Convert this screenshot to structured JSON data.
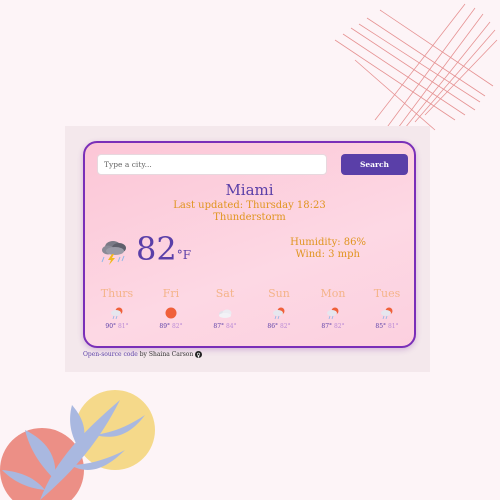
{
  "search": {
    "placeholder": "Type a city...",
    "button_label": "Search"
  },
  "current": {
    "city": "Miami",
    "last_updated": "Last updated: Thursday 18:23",
    "condition": "Thunderstorm",
    "temperature": "82",
    "unit": "°F",
    "humidity": "Humidity: 86%",
    "wind": "Wind: 3 mph",
    "icon": "thunderstorm-icon"
  },
  "forecast": [
    {
      "day": "Thurs",
      "high": "90°",
      "low": "81°",
      "icon": "rain-icon"
    },
    {
      "day": "Fri",
      "high": "89°",
      "low": "82°",
      "icon": "sun-icon"
    },
    {
      "day": "Sat",
      "high": "87°",
      "low": "84°",
      "icon": "cloud-icon"
    },
    {
      "day": "Sun",
      "high": "86°",
      "low": "82°",
      "icon": "rain-icon"
    },
    {
      "day": "Mon",
      "high": "87°",
      "low": "82°",
      "icon": "rain-icon"
    },
    {
      "day": "Tues",
      "high": "85°",
      "low": "81°",
      "icon": "rain-icon"
    }
  ],
  "footer": {
    "link_text": "Open-source code",
    "credit": " by Shaina Carson",
    "icon": "github-icon"
  },
  "colors": {
    "accent": "#5a3fa8",
    "card_border": "#7a2fb8",
    "secondary_text": "#e09520",
    "day_label": "#f4b48a",
    "low_temp": "#b98ad6"
  }
}
